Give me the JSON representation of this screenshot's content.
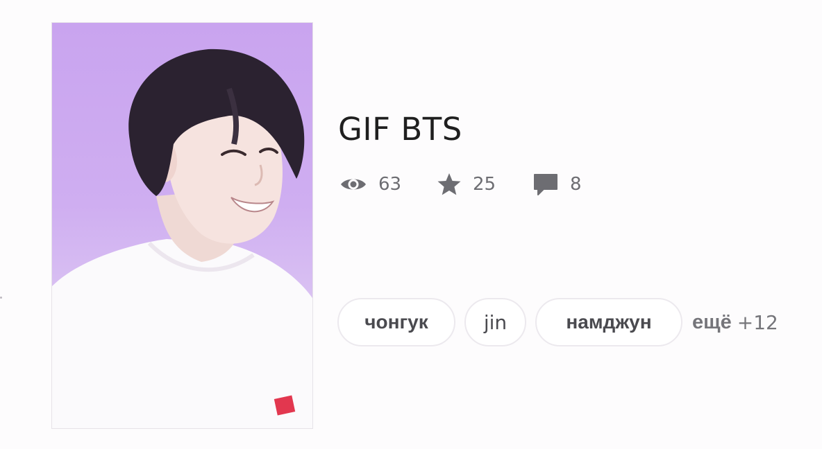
{
  "post": {
    "title": "GIF BTS",
    "stats": {
      "views": "63",
      "stars": "25",
      "comments": "8"
    },
    "tags": [
      "чонгук",
      "jin",
      "намджун"
    ],
    "more_label": "ещё",
    "more_count": "+12"
  },
  "icons": {
    "views": "eye-icon",
    "stars": "star-icon",
    "comments": "comment-bubble-icon"
  },
  "colors": {
    "cover_background": "#c9a4ef",
    "text_primary": "#1f1f1f",
    "text_muted": "#6d6d72",
    "tag_border": "#ece9ee"
  }
}
